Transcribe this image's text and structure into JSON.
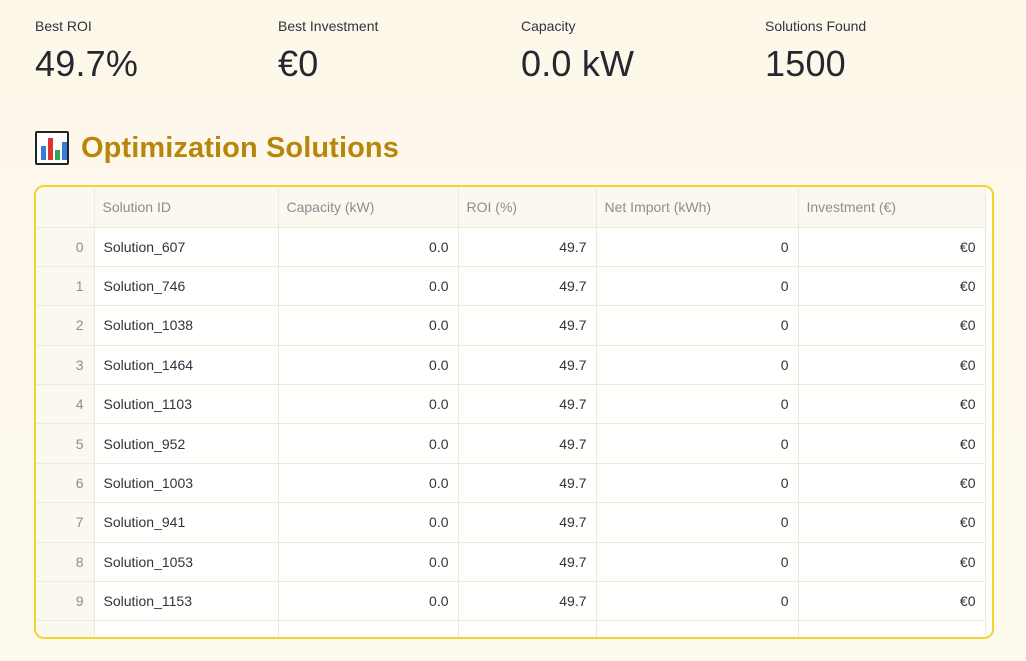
{
  "metrics": [
    {
      "label": "Best ROI",
      "value": "49.7%"
    },
    {
      "label": "Best Investment",
      "value": "€0"
    },
    {
      "label": "Capacity",
      "value": "0.0 kW"
    },
    {
      "label": "Solutions Found",
      "value": "1500"
    }
  ],
  "section": {
    "icon": "bar-chart-icon",
    "title": "Optimization Solutions"
  },
  "table": {
    "columns": [
      "",
      "Solution ID",
      "Capacity (kW)",
      "ROI (%)",
      "Net Import (kWh)",
      "Investment (€)"
    ],
    "rows": [
      [
        "0",
        "Solution_607",
        "0.0",
        "49.7",
        "0",
        "€0"
      ],
      [
        "1",
        "Solution_746",
        "0.0",
        "49.7",
        "0",
        "€0"
      ],
      [
        "2",
        "Solution_1038",
        "0.0",
        "49.7",
        "0",
        "€0"
      ],
      [
        "3",
        "Solution_1464",
        "0.0",
        "49.7",
        "0",
        "€0"
      ],
      [
        "4",
        "Solution_1103",
        "0.0",
        "49.7",
        "0",
        "€0"
      ],
      [
        "5",
        "Solution_952",
        "0.0",
        "49.7",
        "0",
        "€0"
      ],
      [
        "6",
        "Solution_1003",
        "0.0",
        "49.7",
        "0",
        "€0"
      ],
      [
        "7",
        "Solution_941",
        "0.0",
        "49.7",
        "0",
        "€0"
      ],
      [
        "8",
        "Solution_1053",
        "0.0",
        "49.7",
        "0",
        "€0"
      ],
      [
        "9",
        "Solution_1153",
        "0.0",
        "49.7",
        "0",
        "€0"
      ]
    ]
  }
}
